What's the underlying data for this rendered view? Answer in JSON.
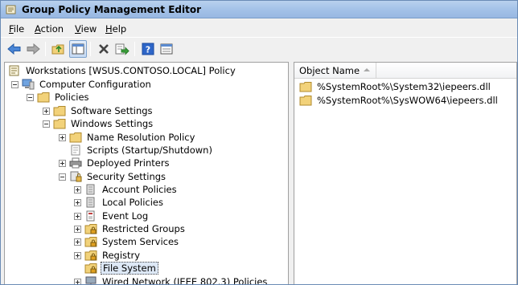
{
  "window": {
    "title": "Group Policy Management Editor"
  },
  "menu": {
    "file": {
      "hot": "F",
      "rest": "ile"
    },
    "action": {
      "hot": "A",
      "rest": "ction"
    },
    "view": {
      "hot": "V",
      "rest": "iew"
    },
    "help": {
      "hot": "H",
      "rest": "elp"
    }
  },
  "toolbar": {
    "buttons": [
      "back-icon",
      "forward-icon",
      "up-folder-icon",
      "show-hide-tree-icon",
      "delete-icon",
      "export-list-icon",
      "help-icon",
      "properties-view-icon"
    ]
  },
  "tree": {
    "items": [
      {
        "label": "Workstations [WSUS.CONTOSO.LOCAL] Policy",
        "icon": "policy-scroll-icon",
        "expander": "none"
      },
      {
        "label": "Computer Configuration",
        "icon": "computer-icon",
        "expander": "minus"
      },
      {
        "label": "Policies",
        "icon": "folder-icon",
        "expander": "minus"
      },
      {
        "label": "Software Settings",
        "icon": "folder-icon",
        "expander": "plus"
      },
      {
        "label": "Windows Settings",
        "icon": "folder-icon",
        "expander": "minus"
      },
      {
        "label": "Name Resolution Policy",
        "icon": "folder-icon",
        "expander": "plus"
      },
      {
        "label": "Scripts (Startup/Shutdown)",
        "icon": "script-icon",
        "expander": "none"
      },
      {
        "label": "Deployed Printers",
        "icon": "printer-icon",
        "expander": "plus"
      },
      {
        "label": "Security Settings",
        "icon": "security-icon",
        "expander": "minus"
      },
      {
        "label": "Account Policies",
        "icon": "security-folder-icon",
        "expander": "plus"
      },
      {
        "label": "Local Policies",
        "icon": "security-folder-icon",
        "expander": "plus"
      },
      {
        "label": "Event Log",
        "icon": "event-log-icon",
        "expander": "plus"
      },
      {
        "label": "Restricted Groups",
        "icon": "locked-folder-icon",
        "expander": "plus"
      },
      {
        "label": "System Services",
        "icon": "locked-folder-icon",
        "expander": "plus"
      },
      {
        "label": "Registry",
        "icon": "locked-folder-icon",
        "expander": "plus"
      },
      {
        "label": "File System",
        "icon": "locked-folder-icon",
        "expander": "none",
        "selected": true
      },
      {
        "label": "Wired Network (IEEE 802.3) Policies",
        "icon": "network-icon",
        "expander": "plus"
      }
    ]
  },
  "list": {
    "column_header": "Object Name",
    "rows": [
      "%SystemRoot%\\System32\\iepeers.dll",
      "%SystemRoot%\\SysWOW64\\iepeers.dll"
    ]
  },
  "colors": {
    "titlebar": "#a4c2e8",
    "folder": "#f2d27a",
    "selection": "#dde8f6"
  }
}
